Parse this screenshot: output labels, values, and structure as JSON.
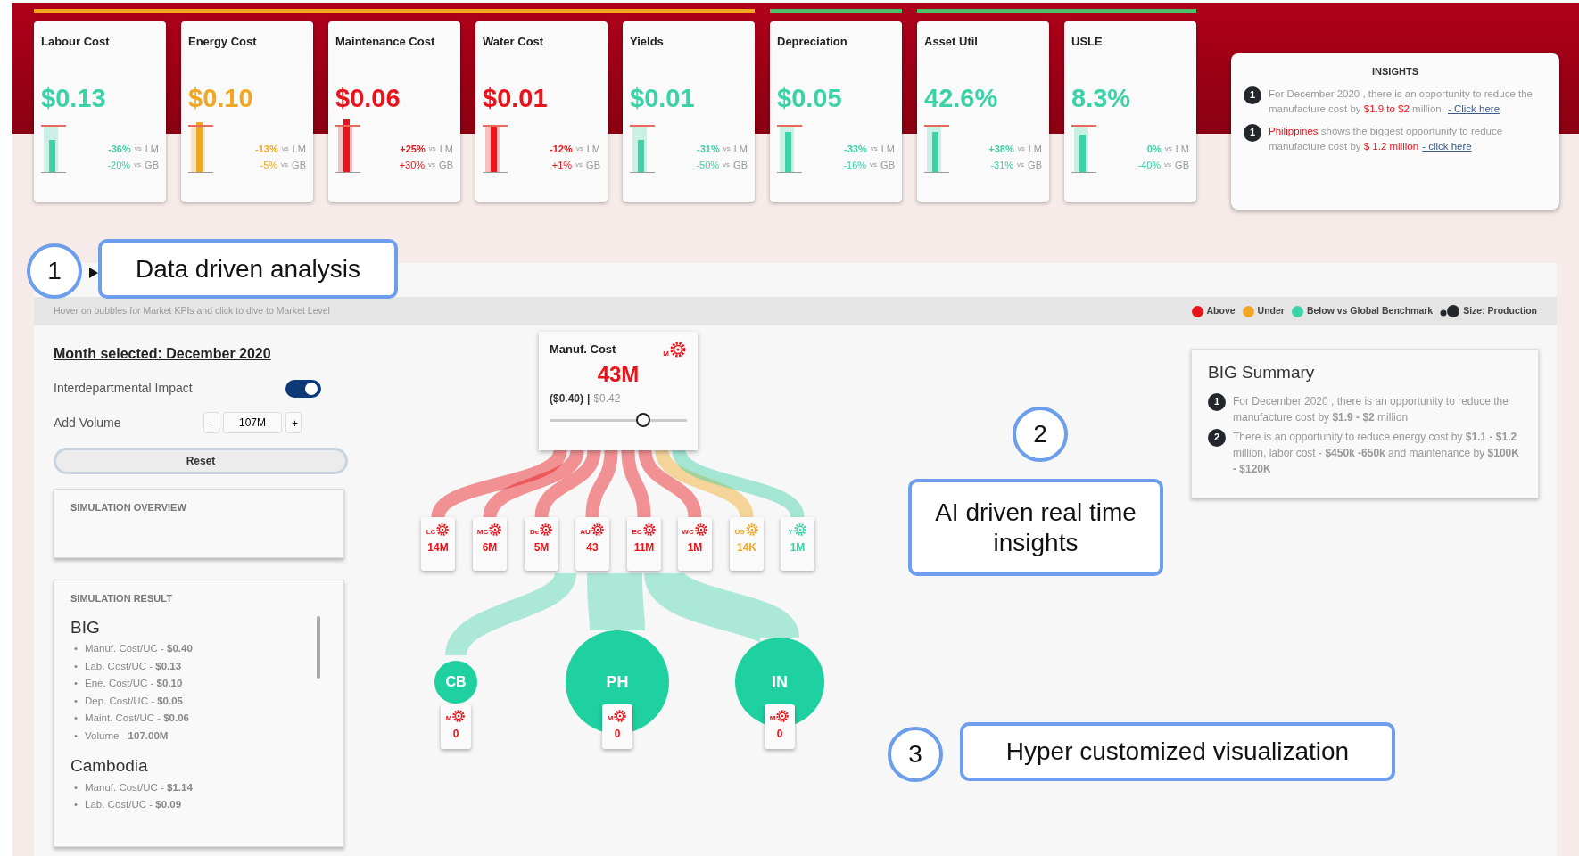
{
  "kpi_cards": [
    {
      "title": "Labour Cost",
      "value": "$0.13",
      "color": "#3dd1a7",
      "strip": {
        "color": "#f5a623"
      },
      "level": 0.62,
      "comparisons": [
        {
          "delta": "-36%",
          "vs": "vs",
          "ref": "LM"
        },
        {
          "delta": "-20%",
          "vs": "vs",
          "ref": "GB"
        }
      ]
    },
    {
      "title": "Energy Cost",
      "value": "$0.10",
      "color": "#f0a824",
      "strip": {
        "color": "#f5a623"
      },
      "level": 0.95,
      "comparisons": [
        {
          "delta": "-13%",
          "vs": "vs",
          "ref": "LM"
        },
        {
          "delta": "-5%",
          "vs": "vs",
          "ref": "GB"
        }
      ]
    },
    {
      "title": "Maintenance Cost",
      "value": "$0.06",
      "color": "#e8141b",
      "strip": {
        "color": "#f5a623"
      },
      "level": 1,
      "comparisons": [
        {
          "delta": "+25%",
          "vs": "vs",
          "ref": "LM"
        },
        {
          "delta": "+30%",
          "vs": "vs",
          "ref": "GB"
        }
      ]
    },
    {
      "title": "Water Cost",
      "value": "$0.01",
      "color": "#e8141b",
      "strip": {
        "color": "#f5a623"
      },
      "level": 0.88,
      "comparisons": [
        {
          "delta": "-12%",
          "vs": "vs",
          "ref": "LM"
        },
        {
          "delta": "+1%",
          "vs": "vs",
          "ref": "GB"
        }
      ]
    },
    {
      "title": "Yields",
      "value": "$0.01",
      "color": "#3dd1a7",
      "strip": {
        "color": "#f5a623"
      },
      "level": 0.62,
      "comparisons": [
        {
          "delta": "-31%",
          "vs": "vs",
          "ref": "LM"
        },
        {
          "delta": "-50%",
          "vs": "vs",
          "ref": "GB"
        }
      ]
    },
    {
      "title": "Depreciation",
      "value": "$0.05",
      "color": "#3dd1a7",
      "strip": {
        "color": "#4cbf6a"
      },
      "level": 0.78,
      "comparisons": [
        {
          "delta": "-33%",
          "vs": "vs",
          "ref": "LM"
        },
        {
          "delta": "-16%",
          "vs": "vs",
          "ref": "GB"
        }
      ]
    },
    {
      "title": "Asset Util",
      "value": "42.6%",
      "color": "#3dd1a7",
      "strip": {
        "color": "#4cbf6a"
      },
      "level": 0.78,
      "comparisons": [
        {
          "delta": "+38%",
          "vs": "vs",
          "ref": "LM"
        },
        {
          "delta": "-31%",
          "vs": "vs",
          "ref": "GB"
        }
      ]
    },
    {
      "title": "USLE",
      "value": "8.3%",
      "color": "#3dd1a7",
      "strip": {
        "color": "#4cbf6a"
      },
      "level": 0.72,
      "comparisons": [
        {
          "delta": "0%",
          "vs": "vs",
          "ref": "LM"
        },
        {
          "delta": "-40%",
          "vs": "vs",
          "ref": "GB"
        }
      ]
    }
  ],
  "insights": {
    "title": "INSIGHTS",
    "items": [
      {
        "number": "1",
        "segments": [
          {
            "kind": "plain",
            "text": "For December 2020 , there is an opportunity to reduce the manufacture cost by "
          },
          {
            "kind": "highlight",
            "text": "$1.9 to $2"
          },
          {
            "kind": "plain",
            "text": " million."
          },
          {
            "kind": "link",
            "text": "- Click here"
          }
        ]
      },
      {
        "number": "1",
        "segments": [
          {
            "kind": "highlight",
            "text": "Philippines"
          },
          {
            "kind": "plain",
            "text": " shows the biggest opportunity to reduce manufacture cost by "
          },
          {
            "kind": "highlight",
            "text": "$ 1.2 million"
          },
          {
            "kind": "link",
            "text": "- click here"
          }
        ]
      }
    ]
  },
  "panel": {
    "hint": "Hover on bubbles for Market KPIs and click to dive to Market Level",
    "legend": [
      {
        "kind": "dot",
        "label": "Above",
        "color": "#e8141b"
      },
      {
        "kind": "dot",
        "label": "Under",
        "color": "#f0a824"
      },
      {
        "kind": "dot",
        "label": "Below vs Global Benchmark",
        "color": "#3dd1a7"
      },
      {
        "kind": "size",
        "label": "Size: Production"
      }
    ]
  },
  "controls": {
    "month": "Month selected: December 2020",
    "impact_label": "Interdepartmental Impact",
    "impact_on": true,
    "volume_label": "Add Volume",
    "minus": "-",
    "volume": "107M",
    "plus": "+",
    "reset": "Reset"
  },
  "simulation_overview": {
    "title": "SIMULATION OVERVIEW"
  },
  "simulation_result": {
    "title": "SIMULATION RESULT",
    "groups": [
      {
        "title": "BIG",
        "bullet": "•",
        "items": [
          "Manuf. Cost/UC - **$0.40**",
          "Lab. Cost/UC - **$0.13**",
          "Ene. Cost/UC - **$0.10**",
          "Dep. Cost/UC - **$0.05**",
          "Maint. Cost/UC - **$0.06**",
          "Volume - **107.00M**"
        ]
      },
      {
        "title": "Cambodia",
        "bullet": "•",
        "items": [
          "Manuf. Cost/UC - **$1.14**",
          "Lab. Cost/UC - **$0.09**"
        ]
      }
    ]
  },
  "flow": {
    "root": {
      "title": "Manuf. Cost",
      "code": "M",
      "value": "43M",
      "actual": "($0.40)",
      "separator": "|",
      "benchmark": "$0.42",
      "slider": {
        "level": 0.68
      }
    },
    "nodes": [
      {
        "code": "LC",
        "value": "14M",
        "color": "#e8141b"
      },
      {
        "code": "MC",
        "value": "6M",
        "color": "#e8141b"
      },
      {
        "code": "De",
        "value": "5M",
        "color": "#e8141b"
      },
      {
        "code": "AU",
        "value": "43",
        "color": "#e8141b"
      },
      {
        "code": "EC",
        "value": "11M",
        "color": "#e8141b"
      },
      {
        "code": "WC",
        "value": "1M",
        "color": "#e8141b"
      },
      {
        "code": "US",
        "value": "14K",
        "color": "#f0a824"
      },
      {
        "code": "Y",
        "value": "1M",
        "color": "#3dd1a7"
      }
    ],
    "markets": [
      {
        "code": "CB",
        "badge_code": "M",
        "badge_value": "0"
      },
      {
        "code": "PH",
        "badge_code": "M",
        "badge_value": "0"
      },
      {
        "code": "IN",
        "badge_code": "M",
        "badge_value": "0"
      }
    ]
  },
  "big_summary": {
    "title": "BIG Summary",
    "items": [
      {
        "number": "1",
        "text": "For December 2020 , there is an opportunity to reduce the manufacture cost by **$1.9 - $2** million"
      },
      {
        "number": "2",
        "text": "There is an opportunity to reduce energy cost by **$1.1 - $1.2** million, labor cost - **$450k -650k** and maintenance by **$100K - $120K**"
      }
    ]
  },
  "callouts": [
    {
      "number": "1",
      "text": "Data driven analysis"
    },
    {
      "number": "2",
      "text": "AI driven real time insights"
    },
    {
      "number": "3",
      "text": "Hyper customized visualization"
    }
  ]
}
